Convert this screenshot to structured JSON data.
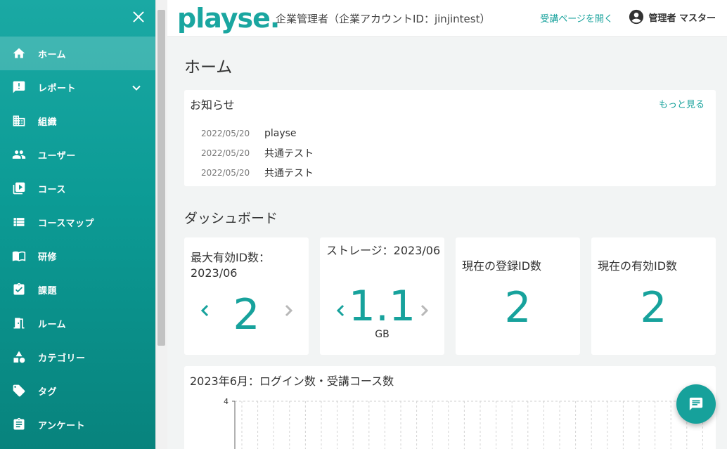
{
  "sidebar": {
    "items": [
      {
        "label": "ホーム",
        "icon": "home-icon"
      },
      {
        "label": "レポート",
        "icon": "report-icon"
      },
      {
        "label": "組織",
        "icon": "building-icon"
      },
      {
        "label": "ユーザー",
        "icon": "users-icon"
      },
      {
        "label": "コース",
        "icon": "play-library-icon"
      },
      {
        "label": "コースマップ",
        "icon": "list-icon"
      },
      {
        "label": "研修",
        "icon": "book-icon"
      },
      {
        "label": "課題",
        "icon": "assignment-icon"
      },
      {
        "label": "ルーム",
        "icon": "door-icon"
      },
      {
        "label": "カテゴリー",
        "icon": "shapes-icon"
      },
      {
        "label": "タグ",
        "icon": "tag-icon"
      },
      {
        "label": "アンケート",
        "icon": "clipboard-icon"
      }
    ]
  },
  "header": {
    "logo": "playse.",
    "company": "企業管理者（企業アカウントID：jinjintest）",
    "open_link": "受講ページを開く",
    "account_name": "管理者 マスター"
  },
  "main": {
    "title": "ホーム",
    "news": {
      "title": "お知らせ",
      "more": "もっと見る",
      "items": [
        {
          "date": "2022/05/20",
          "text": "playse"
        },
        {
          "date": "2022/05/20",
          "text": "共通テスト"
        },
        {
          "date": "2022/05/20",
          "text": "共通テスト"
        }
      ]
    },
    "dashboard": {
      "title": "ダッシュボード",
      "stats": [
        {
          "label": "最大有効ID数：2023/06",
          "value": "2",
          "unit": ""
        },
        {
          "label": "ストレージ：2023/06",
          "value": "1.1",
          "unit": "GB"
        },
        {
          "label": "現在の登録ID数",
          "value": "2",
          "unit": ""
        },
        {
          "label": "現在の有効ID数",
          "value": "2",
          "unit": ""
        }
      ]
    },
    "chart": {
      "title": "2023年6月：ログイン数・受講コース数",
      "y_top_tick": "4"
    }
  },
  "colors": {
    "accent": "#17a29c",
    "sidebar_top": "#1aa9a4",
    "sidebar_bottom": "#08837d"
  },
  "chart_data": {
    "type": "line",
    "title": "2023年6月：ログイン数・受講コース数",
    "yticks": [
      "4"
    ],
    "ylim": [
      0,
      4
    ],
    "grid": true,
    "series": []
  }
}
